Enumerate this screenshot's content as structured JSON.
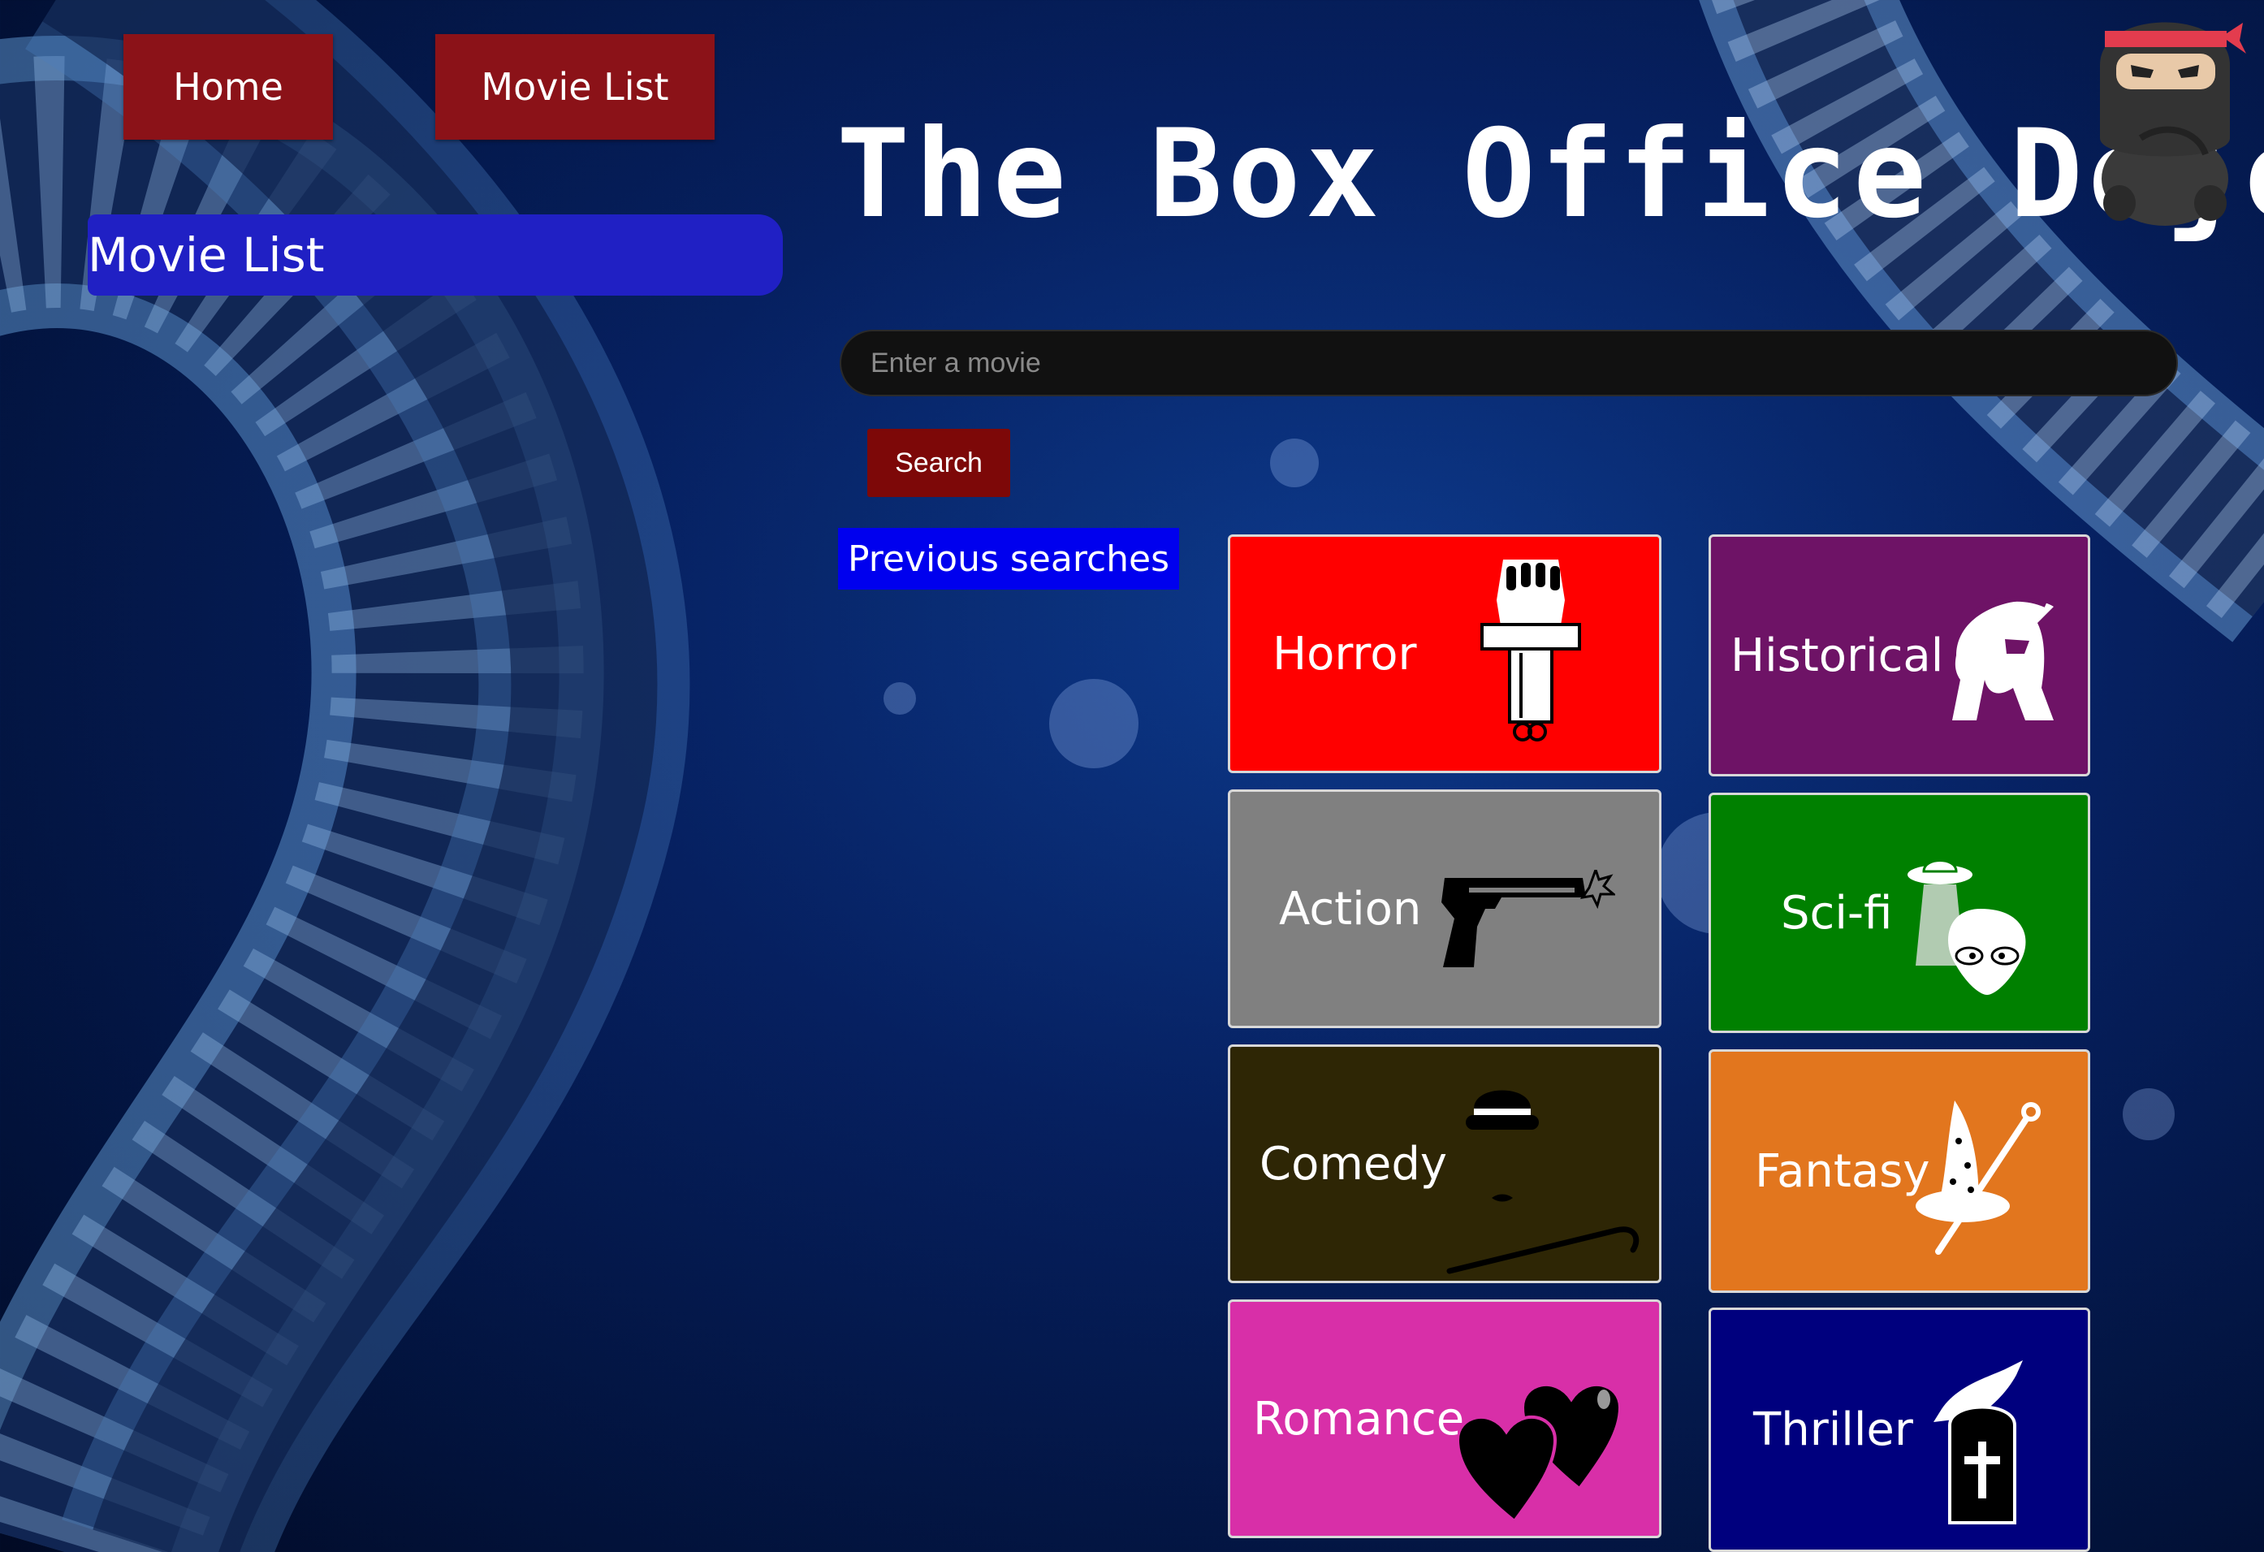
{
  "nav": {
    "home_label": "Home",
    "movie_list_label": "Movie List"
  },
  "sidebar": {
    "heading": "Movie List"
  },
  "header": {
    "title": "The Box Office Dojo",
    "logo_icon": "ninja-icon"
  },
  "search": {
    "placeholder": "Enter a movie",
    "value": "",
    "button_label": "Search"
  },
  "previous_searches": {
    "label": "Previous searches"
  },
  "genres": [
    {
      "label": "Horror",
      "color": "#ff0000",
      "icon": "zombie-hand-icon"
    },
    {
      "label": "Historical",
      "color": "#6e1366",
      "icon": "spartan-helmet-icon"
    },
    {
      "label": "Action",
      "color": "#808080",
      "icon": "pistol-icon"
    },
    {
      "label": "Sci-fi",
      "color": "#008000",
      "icon": "alien-ufo-icon"
    },
    {
      "label": "Comedy",
      "color": "#2e2605",
      "icon": "bowler-hat-cane-icon"
    },
    {
      "label": "Fantasy",
      "color": "#e2761e",
      "icon": "wizard-hat-wand-icon"
    },
    {
      "label": "Romance",
      "color": "#d82fa8",
      "icon": "hearts-icon"
    },
    {
      "label": "Thriller",
      "color": "#00007e",
      "icon": "raven-tombstone-icon"
    }
  ]
}
